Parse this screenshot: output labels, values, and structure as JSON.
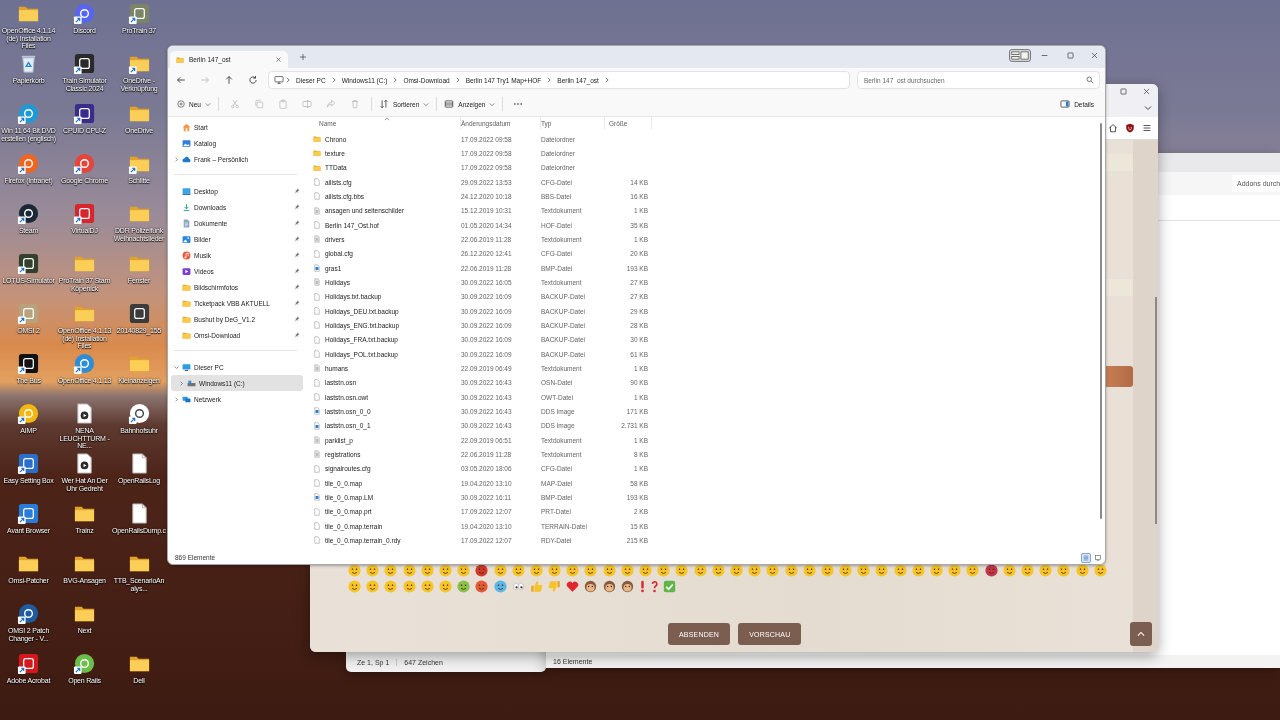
{
  "desktop_icon_rows": [
    [
      {
        "label": "OpenOffice 4.1.14 (de) Installation Files",
        "kind": "folder"
      },
      {
        "label": "Discord",
        "kind": "circle",
        "color": "#5865f2",
        "shortcut": true
      },
      {
        "label": "ProTrain 37",
        "kind": "tile",
        "color": "#7b8466",
        "shortcut": true
      }
    ],
    [
      {
        "label": "Papierkorb",
        "kind": "recycle_bin"
      },
      {
        "label": "Train Simulator Classic 2024",
        "kind": "tile",
        "color": "#2a2a2a",
        "shortcut": true
      },
      {
        "label": "OneDrive - Verknüpfung",
        "kind": "folder",
        "shortcut": true
      }
    ],
    [
      {
        "label": "Win 11 64 Bit DVD erstellen (englisch)",
        "kind": "circle",
        "color": "#1e9ad6",
        "shortcut": true
      },
      {
        "label": "CPUID CPU-Z",
        "kind": "tile",
        "color": "#3a2c8c",
        "shortcut": true
      },
      {
        "label": "OneDrive",
        "kind": "folder"
      }
    ],
    [
      {
        "label": "Firefox (Intranet)",
        "kind": "circle",
        "color": "#f0661e",
        "shortcut": true
      },
      {
        "label": "Google Chrome",
        "kind": "circle",
        "color": "#e5453a",
        "shortcut": true
      },
      {
        "label": "Schlitte",
        "kind": "folder",
        "shortcut": true
      }
    ],
    [
      {
        "label": "Steam",
        "kind": "circle",
        "color": "#1b2838",
        "shortcut": true
      },
      {
        "label": "VirtualDJ",
        "kind": "tile",
        "color": "#d8262e",
        "shortcut": true
      },
      {
        "label": "DDR Polizeifunk Weihnachtslieder",
        "kind": "folder"
      }
    ],
    [
      {
        "label": "LOTUS-Simulator",
        "kind": "tile",
        "color": "#33402c",
        "shortcut": true
      },
      {
        "label": "ProTrain 37 Stam Köpenick",
        "kind": "folder"
      },
      {
        "label": "Fenster",
        "kind": "folder"
      }
    ],
    [
      {
        "label": "OMSI 2",
        "kind": "tile",
        "color": "#b8a27c",
        "shortcut": true
      },
      {
        "label": "OpenOffice 4.1.13 (de) Installation Files",
        "kind": "folder"
      },
      {
        "label": "20140829_155",
        "kind": "tile",
        "color": "#3b3b3b"
      }
    ],
    [
      {
        "label": "The Bus",
        "kind": "tile",
        "color": "#121212",
        "shortcut": true
      },
      {
        "label": "OpenOffice 4.1.13",
        "kind": "circle",
        "color": "#2d8ed6",
        "shortcut": true
      },
      {
        "label": "Kleinanzeigen",
        "kind": "folder"
      }
    ],
    [
      {
        "label": "AIMP",
        "kind": "circle",
        "color": "#f2b80f",
        "shortcut": true
      },
      {
        "label": "NENA LEUCHTTURM - NE...",
        "kind": "media"
      },
      {
        "label": "Bahnhofsuhr",
        "kind": "circle",
        "color": "#ffffff",
        "shortcut": true
      }
    ],
    [
      {
        "label": "Easy Setting Box",
        "kind": "tile",
        "color": "#2b6fca",
        "shortcut": true
      },
      {
        "label": "Wer Hat An Der Uhr Gedreht",
        "kind": "media"
      },
      {
        "label": "OpenRailsLog",
        "kind": "document"
      }
    ],
    [
      {
        "label": "Avant Browser",
        "kind": "tile",
        "color": "#2b7bd8",
        "shortcut": true
      },
      {
        "label": "Trainz",
        "kind": "folder"
      },
      {
        "label": "OpenRailsDump.c",
        "kind": "document"
      }
    ],
    [
      {
        "label": "Omsi-Patcher",
        "kind": "folder"
      },
      {
        "label": "BVG-Ansagen",
        "kind": "folder"
      },
      {
        "label": "TTB_ScenarioAnalys...",
        "kind": "folder"
      }
    ],
    [
      {
        "label": "OMSI 2 Patch Changer - V...",
        "kind": "circle",
        "color": "#1f5b9f",
        "shortcut": true
      },
      {
        "label": "Next",
        "kind": "folder"
      }
    ],
    [
      {
        "label": "Adobe Acrobat",
        "kind": "tile",
        "color": "#d3181e",
        "shortcut": true
      },
      {
        "label": "Open Rails",
        "kind": "circle",
        "color": "#6bbf48",
        "shortcut": true
      },
      {
        "label": "Dell",
        "kind": "folder"
      }
    ]
  ],
  "editor_window": {
    "status": [
      "Ze 1, Sp 1",
      "647 Zeichen"
    ]
  },
  "files_window": {
    "search": {
      "placeholder": "Addons durch"
    },
    "status": "16 Elemente"
  },
  "browser": {
    "emoji_rows": [
      [
        {
          "kind": "face",
          "color": "#f6c429"
        },
        {
          "kind": "face",
          "color": "#f6c429"
        },
        {
          "kind": "face",
          "color": "#f6c429"
        },
        {
          "kind": "face",
          "color": "#f6c429"
        },
        {
          "kind": "face",
          "color": "#f6c429"
        },
        {
          "kind": "face",
          "color": "#f6c429"
        },
        {
          "kind": "face",
          "color": "#f6c429"
        },
        {
          "kind": "face",
          "color": "#d0392b"
        },
        {
          "kind": "face",
          "color": "#f6c429"
        },
        {
          "kind": "face",
          "color": "#f6c429"
        },
        {
          "kind": "face",
          "color": "#f6c429"
        },
        {
          "kind": "face",
          "color": "#f6c429"
        },
        {
          "kind": "face",
          "color": "#f6c429"
        },
        {
          "kind": "face",
          "color": "#f6c429"
        },
        {
          "kind": "face",
          "color": "#f6c429"
        },
        {
          "kind": "face",
          "color": "#f6c429"
        },
        {
          "kind": "face",
          "color": "#f6c429"
        },
        {
          "kind": "face",
          "color": "#f6c429"
        },
        {
          "kind": "face",
          "color": "#f6c429"
        },
        {
          "kind": "face",
          "color": "#f6c429"
        },
        {
          "kind": "face",
          "color": "#f6c429"
        },
        {
          "kind": "face",
          "color": "#f6c429"
        },
        {
          "kind": "face",
          "color": "#f6c429"
        },
        {
          "kind": "face",
          "color": "#f6c429"
        },
        {
          "kind": "face",
          "color": "#f6c429"
        },
        {
          "kind": "face",
          "color": "#f6c429"
        },
        {
          "kind": "face",
          "color": "#f6c429"
        },
        {
          "kind": "face",
          "color": "#f6c429"
        },
        {
          "kind": "face",
          "color": "#f6c429"
        },
        {
          "kind": "face",
          "color": "#f6c429"
        },
        {
          "kind": "face",
          "color": "#f6c429"
        },
        {
          "kind": "face",
          "color": "#f6c429"
        },
        {
          "kind": "face",
          "color": "#f6c429"
        },
        {
          "kind": "face",
          "color": "#f6c429"
        },
        {
          "kind": "face",
          "color": "#f6c429"
        },
        {
          "kind": "face",
          "color": "#c2354a"
        },
        {
          "kind": "face",
          "color": "#f6c429"
        },
        {
          "kind": "face",
          "color": "#f6c429"
        },
        {
          "kind": "face",
          "color": "#f6c429"
        },
        {
          "kind": "face",
          "color": "#f6c429"
        },
        {
          "kind": "face",
          "color": "#f6c429"
        },
        {
          "kind": "face",
          "color": "#f6c429"
        }
      ],
      [
        {
          "kind": "face",
          "color": "#f6c429"
        },
        {
          "kind": "face",
          "color": "#f6c429"
        },
        {
          "kind": "face",
          "color": "#f6c429"
        },
        {
          "kind": "face",
          "color": "#f6c429"
        },
        {
          "kind": "face",
          "color": "#f6c429"
        },
        {
          "kind": "face",
          "color": "#f6c429"
        },
        {
          "kind": "face",
          "color": "#8cc04b"
        },
        {
          "kind": "face",
          "color": "#e55a36"
        },
        {
          "kind": "face",
          "color": "#59b7e8"
        },
        {
          "kind": "eyes"
        },
        {
          "kind": "thumbs_up"
        },
        {
          "kind": "thumbs_down"
        },
        {
          "kind": "heart"
        },
        {
          "kind": "monkey"
        },
        {
          "kind": "monkey"
        },
        {
          "kind": "monkey"
        },
        {
          "kind": "exclamation"
        },
        {
          "kind": "question"
        },
        {
          "kind": "check"
        }
      ]
    ],
    "buttons": [
      "ABSENDEN",
      "VORSCHAU"
    ]
  },
  "explorer": {
    "tabs": [
      {
        "title": "Berlin 147_ost",
        "selected": true
      }
    ],
    "nav": [
      {
        "kind": "back"
      },
      {
        "kind": "forward",
        "disabled": true
      },
      {
        "kind": "up"
      },
      {
        "kind": "refresh"
      }
    ],
    "breadcrumb": [
      "Dieser PC",
      "Windows11 (C:)",
      "Omsi-Download",
      "Berlin 147 Try1 Map+HOF",
      "Berlin 147_ost"
    ],
    "search": {
      "placeholder": "Berlin 147_ost durchsuchen"
    },
    "toolbar": {
      "new_label": "Neu",
      "actions": [
        {
          "kind": "cut",
          "disabled": true
        },
        {
          "kind": "copy",
          "disabled": true
        },
        {
          "kind": "paste",
          "disabled": true
        },
        {
          "kind": "rename",
          "disabled": true
        },
        {
          "kind": "share",
          "disabled": true
        },
        {
          "kind": "delete",
          "disabled": true
        }
      ],
      "sort_label": "Sortieren",
      "view_label": "Anzeigen",
      "details_label": "Details"
    },
    "sidebar": {
      "groups": [
        [
          {
            "label": "Start",
            "kind": "home",
            "selected": false
          },
          {
            "label": "Katalog",
            "kind": "gallery",
            "selected": false
          },
          {
            "label": "Frank – Persönlich",
            "kind": "cloud",
            "expanded": false,
            "selected": false
          }
        ],
        [
          {
            "label": "Desktop",
            "kind": "desktop",
            "pinned": true,
            "selected": false
          },
          {
            "label": "Downloads",
            "kind": "download",
            "pinned": true,
            "selected": false
          },
          {
            "label": "Dokumente",
            "kind": "documents",
            "pinned": true,
            "selected": false
          },
          {
            "label": "Bilder",
            "kind": "pictures",
            "pinned": true,
            "selected": false
          },
          {
            "label": "Musik",
            "kind": "music",
            "pinned": true,
            "selected": false
          },
          {
            "label": "Videos",
            "kind": "videos",
            "pinned": true,
            "selected": false
          },
          {
            "label": "Bildschirmfotos",
            "kind": "folder",
            "pinned": true,
            "selected": false
          },
          {
            "label": "Ticketpack VBB AKTUELL",
            "kind": "folder",
            "pinned": true,
            "selected": false
          },
          {
            "label": "Bushut by DeG_V1.2",
            "kind": "folder",
            "pinned": true,
            "selected": false
          },
          {
            "label": "Omsi-Download",
            "kind": "folder",
            "pinned": true,
            "selected": false
          }
        ],
        [
          {
            "label": "Dieser PC",
            "kind": "computer",
            "expanded": true,
            "selected": false,
            "children": [
              {
                "label": "Windows11 (C:)",
                "kind": "drive",
                "expanded": false,
                "selected": true
              }
            ]
          },
          {
            "label": "Netzwerk",
            "kind": "network",
            "expanded": false,
            "selected": false
          }
        ]
      ]
    },
    "columns": [
      {
        "label": "Name",
        "sorted": true
      },
      {
        "label": "Änderungsdatum"
      },
      {
        "label": "Typ"
      },
      {
        "label": "Größe"
      }
    ],
    "files": [
      {
        "name": "Chrono",
        "modified": "17.09.2022 09:58",
        "type": "Dateiordner",
        "kind": "folder"
      },
      {
        "name": "texture",
        "modified": "17.09.2022 09:58",
        "type": "Dateiordner",
        "kind": "folder"
      },
      {
        "name": "TTData",
        "modified": "17.09.2022 09:58",
        "type": "Dateiordner",
        "kind": "folder"
      },
      {
        "name": "ailists.cfg",
        "modified": "29.09.2022 13:53",
        "type": "CFG-Datei",
        "size": "14 KB",
        "kind": "file"
      },
      {
        "name": "ailists.cfg.bbs",
        "modified": "24.12.2020 10:18",
        "type": "BBS-Datei",
        "size": "16 KB",
        "kind": "file"
      },
      {
        "name": "ansagen und seitenschilder",
        "modified": "15.12.2019 10:31",
        "type": "Textdokument",
        "size": "1 KB",
        "kind": "text"
      },
      {
        "name": "Berlin 147_Ost.hof",
        "modified": "01.05.2020 14:34",
        "type": "HOF-Datei",
        "size": "35 KB",
        "kind": "file"
      },
      {
        "name": "drivers",
        "modified": "22.06.2019 11:28",
        "type": "Textdokument",
        "size": "1 KB",
        "kind": "text"
      },
      {
        "name": "global.cfg",
        "modified": "26.12.2020 12:41",
        "type": "CFG-Datei",
        "size": "20 KB",
        "kind": "file"
      },
      {
        "name": "gras1",
        "modified": "22.06.2019 11:28",
        "type": "BMP-Datei",
        "size": "193 KB",
        "kind": "image"
      },
      {
        "name": "Holidays",
        "modified": "30.09.2022 16:05",
        "type": "Textdokument",
        "size": "27 KB",
        "kind": "text"
      },
      {
        "name": "Holidays.txt.backup",
        "modified": "30.09.2022 16:09",
        "type": "BACKUP-Datei",
        "size": "27 KB",
        "kind": "file"
      },
      {
        "name": "Holidays_DEU.txt.backup",
        "modified": "30.09.2022 16:09",
        "type": "BACKUP-Datei",
        "size": "29 KB",
        "kind": "file"
      },
      {
        "name": "Holidays_ENG.txt.backup",
        "modified": "30.09.2022 16:09",
        "type": "BACKUP-Datei",
        "size": "28 KB",
        "kind": "file"
      },
      {
        "name": "Holidays_FRA.txt.backup",
        "modified": "30.09.2022 16:09",
        "type": "BACKUP-Datei",
        "size": "30 KB",
        "kind": "file"
      },
      {
        "name": "Holidays_POL.txt.backup",
        "modified": "30.09.2022 16:09",
        "type": "BACKUP-Datei",
        "size": "61 KB",
        "kind": "file"
      },
      {
        "name": "humans",
        "modified": "22.09.2019 06:49",
        "type": "Textdokument",
        "size": "1 KB",
        "kind": "text"
      },
      {
        "name": "laststn.osn",
        "modified": "30.09.2022 16:43",
        "type": "OSN-Datei",
        "size": "90 KB",
        "kind": "file"
      },
      {
        "name": "laststn.osn.owt",
        "modified": "30.09.2022 16:43",
        "type": "OWT-Datei",
        "size": "1 KB",
        "kind": "file"
      },
      {
        "name": "laststn.osn_0_0",
        "modified": "30.09.2022 16:43",
        "type": "DDS Image",
        "size": "171 KB",
        "kind": "image"
      },
      {
        "name": "laststn.osn_0_1",
        "modified": "30.09.2022 16:43",
        "type": "DDS Image",
        "size": "2.731 KB",
        "kind": "image"
      },
      {
        "name": "parklist_p",
        "modified": "22.09.2019 06:51",
        "type": "Textdokument",
        "size": "1 KB",
        "kind": "text"
      },
      {
        "name": "registrations",
        "modified": "22.06.2019 11:28",
        "type": "Textdokument",
        "size": "8 KB",
        "kind": "text"
      },
      {
        "name": "signalroutes.cfg",
        "modified": "03.05.2020 18:06",
        "type": "CFG-Datei",
        "size": "1 KB",
        "kind": "file"
      },
      {
        "name": "tile_0_0.map",
        "modified": "19.04.2020 13:10",
        "type": "MAP-Datei",
        "size": "58 KB",
        "kind": "file"
      },
      {
        "name": "tile_0_0.map.LM",
        "modified": "30.09.2022 16:11",
        "type": "BMP-Datei",
        "size": "193 KB",
        "kind": "image"
      },
      {
        "name": "tile_0_0.map.prt",
        "modified": "17.09.2022 12:07",
        "type": "PRT-Datei",
        "size": "2 KB",
        "kind": "file"
      },
      {
        "name": "tile_0_0.map.terrain",
        "modified": "19.04.2020 13:10",
        "type": "TERRAIN-Datei",
        "size": "15 KB",
        "kind": "file"
      },
      {
        "name": "tile_0_0.map.terrain_0.rdy",
        "modified": "17.09.2022 12:07",
        "type": "RDY-Datei",
        "size": "215 KB",
        "kind": "file"
      }
    ],
    "status": "869 Elemente",
    "views": [
      {
        "kind": "details",
        "selected": true
      },
      {
        "kind": "tiles",
        "selected": false
      }
    ]
  }
}
